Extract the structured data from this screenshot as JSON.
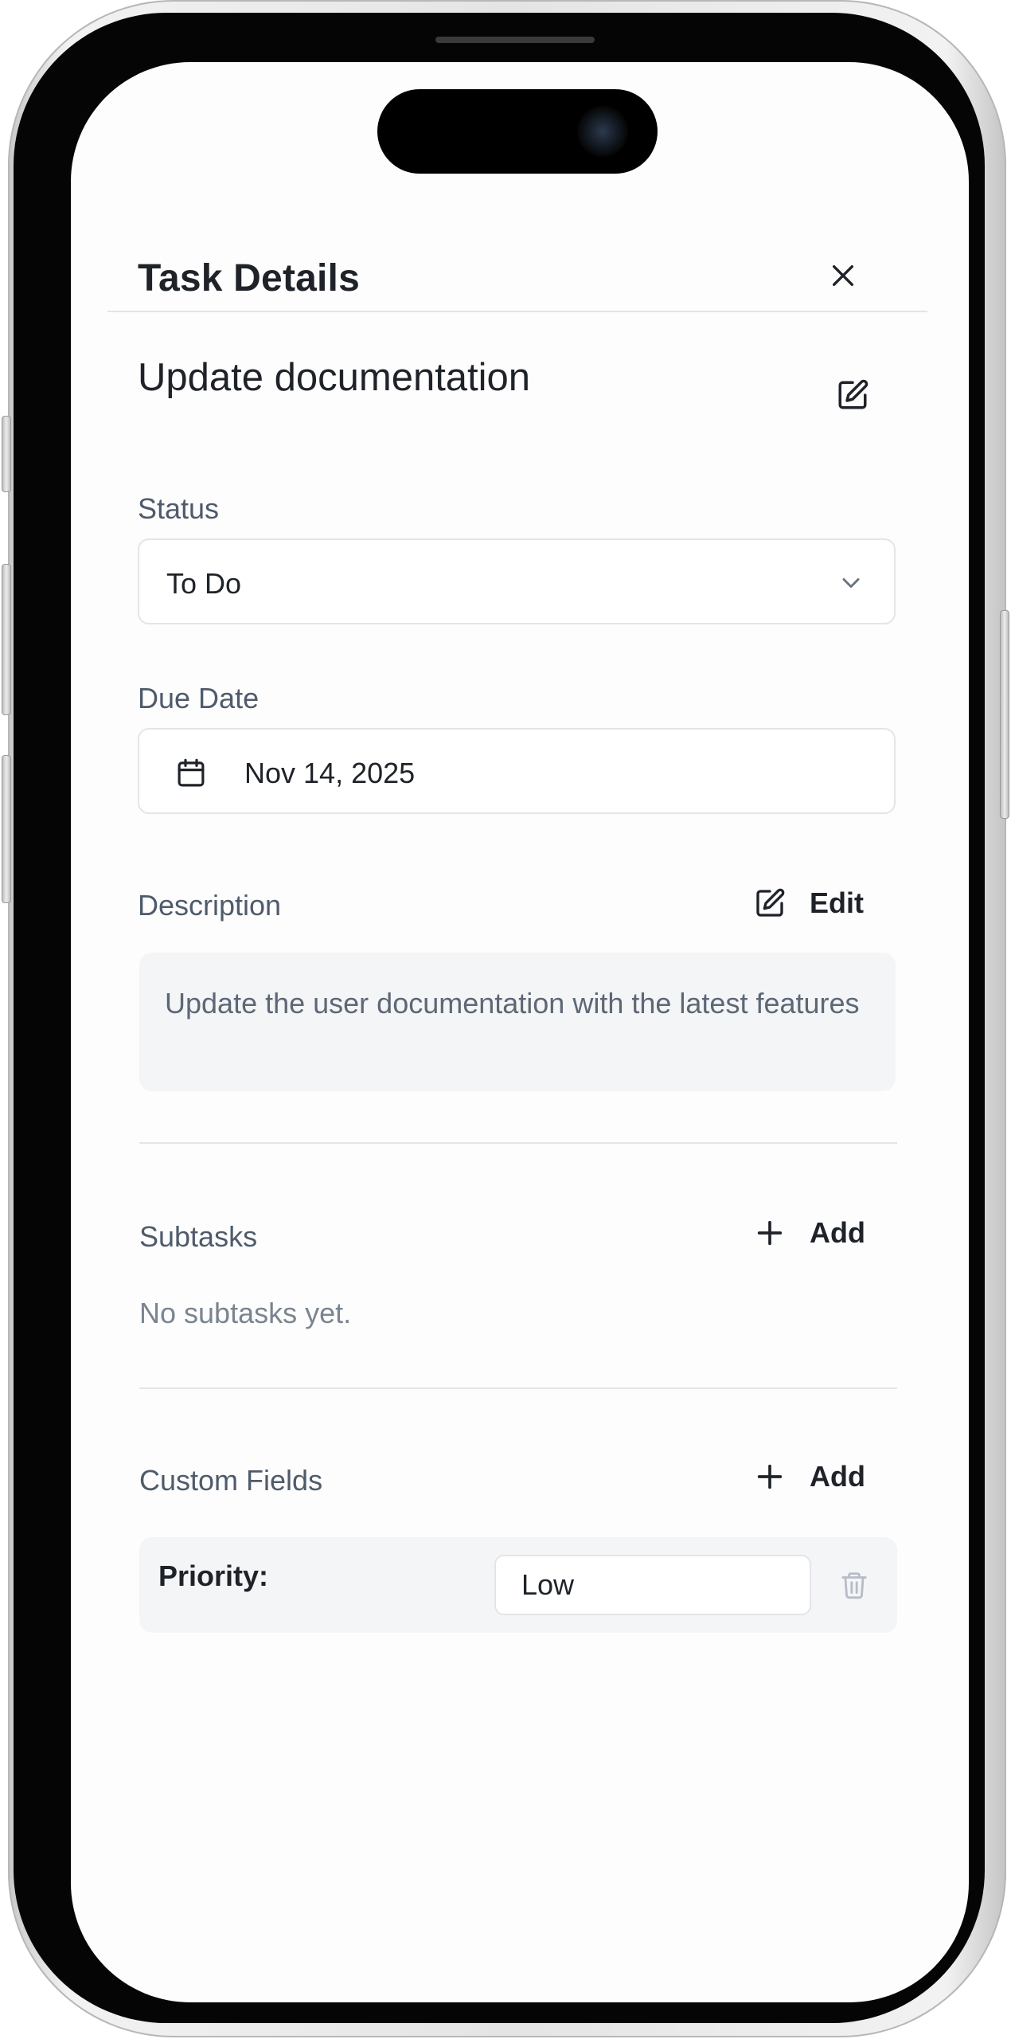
{
  "header": {
    "title": "Task Details"
  },
  "task": {
    "title": "Update documentation"
  },
  "status": {
    "label": "Status",
    "value": "To Do"
  },
  "due_date": {
    "label": "Due Date",
    "value": "Nov 14, 2025"
  },
  "description": {
    "label": "Description",
    "edit_label": "Edit",
    "text": "Update the user documentation with the latest features"
  },
  "subtasks": {
    "label": "Subtasks",
    "add_label": "Add",
    "empty_text": "No subtasks yet."
  },
  "custom_fields": {
    "label": "Custom Fields",
    "add_label": "Add",
    "items": [
      {
        "name": "Priority:",
        "value": "Low"
      }
    ]
  },
  "icons": {
    "close": "close-icon",
    "title_edit": "edit-icon",
    "status_chevron": "chevron-down-icon",
    "calendar": "calendar-icon",
    "description_edit": "edit-icon",
    "subtask_add": "plus-icon",
    "custom_field_add": "plus-icon",
    "delete": "trash-icon"
  },
  "colors": {
    "text_primary": "#1f2329",
    "label": "#4f5b6b",
    "muted": "#7b8491",
    "border": "#e3e5e8",
    "panel_bg": "#f4f5f7",
    "trash": "#b7bdc6"
  }
}
